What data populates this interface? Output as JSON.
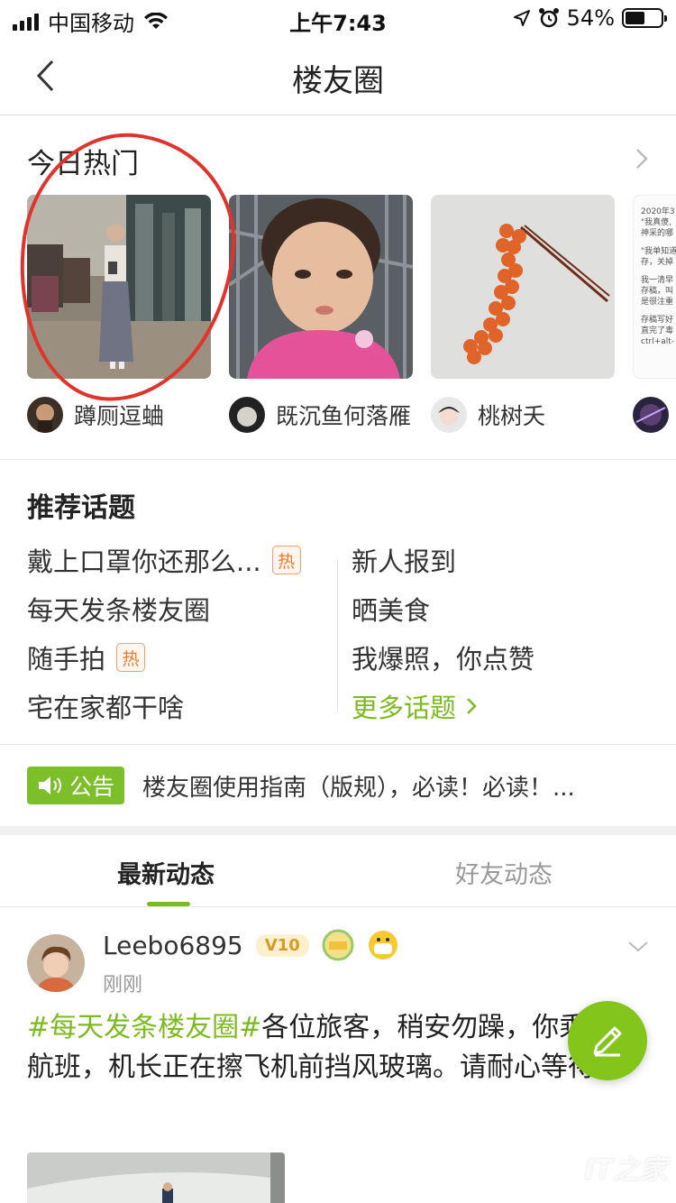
{
  "status_bar": {
    "carrier": "中国移动",
    "time": "上午7:43",
    "battery_percent": "54%",
    "battery_level": 0.54
  },
  "nav": {
    "title": "楼友圈"
  },
  "hot": {
    "title": "今日热门",
    "users": [
      {
        "name": "蹲厕逗蛐"
      },
      {
        "name": "既沉鱼何落雁"
      },
      {
        "name": "桃树夭"
      }
    ],
    "note_card_lines": [
      "2020年3",
      "\"我真傻,",
      "神采的哪",
      "\"我单知道",
      "存，关掉",
      "我一清早",
      "存稿，叫",
      "是很注重",
      "存稿写好",
      "直完了毒",
      "ctrl+alt-"
    ]
  },
  "topics": {
    "title": "推荐话题",
    "hot_badge": "热",
    "left": [
      {
        "label": "戴上口罩你还那么...",
        "hot": true
      },
      {
        "label": "每天发条楼友圈",
        "hot": false
      },
      {
        "label": "随手拍",
        "hot": true
      },
      {
        "label": "宅在家都干啥",
        "hot": false
      }
    ],
    "right": [
      {
        "label": "新人报到"
      },
      {
        "label": "晒美食"
      },
      {
        "label": "我爆照，你点赞"
      }
    ],
    "more": "更多话题"
  },
  "notice": {
    "badge": "公告",
    "text": "楼友圈使用指南（版规），必读！必读！..."
  },
  "tabs": {
    "active": "最新动态",
    "inactive": "好友动态"
  },
  "post": {
    "username": "Leebo6895",
    "vip": "V10",
    "time": "刚刚",
    "tag": "#每天发条楼友圈#",
    "text": "各位旅客，稍安勿躁，你乘坐的航班，机长正在擦飞机前挡风玻璃。请耐心等待~"
  },
  "watermark": "IT之家",
  "colors": {
    "accent_green": "#7cbb1e",
    "hot_orange": "#f07c2e",
    "annotation_red": "#e0332b"
  }
}
